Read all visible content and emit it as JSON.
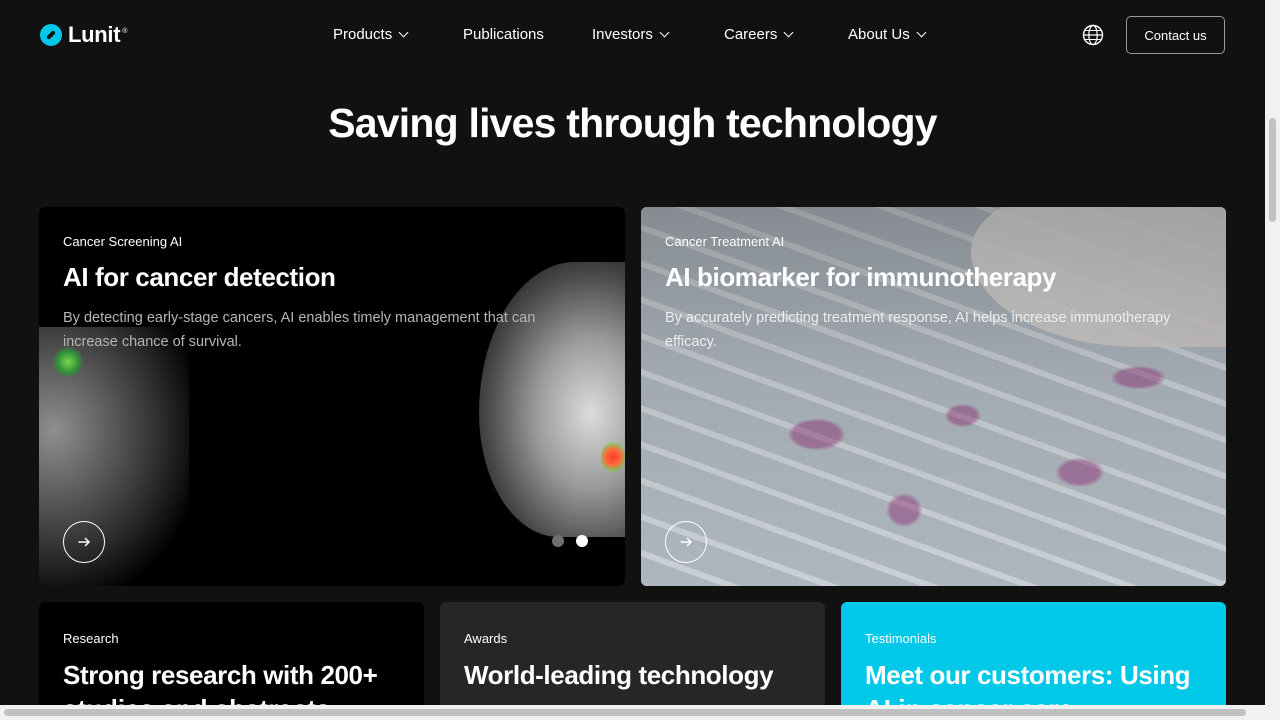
{
  "brand": {
    "name": "Lunit",
    "reg_mark": "®",
    "accent": "#00c8e8",
    "background": "#111111"
  },
  "nav": {
    "items": [
      {
        "label": "Products",
        "has_dropdown": true
      },
      {
        "label": "Publications",
        "has_dropdown": false
      },
      {
        "label": "Investors",
        "has_dropdown": true
      },
      {
        "label": "Careers",
        "has_dropdown": true
      },
      {
        "label": "About Us",
        "has_dropdown": true
      }
    ],
    "language_icon": "globe-icon",
    "contact_label": "Contact us"
  },
  "hero": {
    "title": "Saving lives through technology"
  },
  "feature_cards": [
    {
      "label": "Cancer Screening AI",
      "title": "AI for cancer detection",
      "description": "By detecting early-stage cancers, AI enables timely management that can increase chance of survival.",
      "arrow_icon": "arrow-right-icon",
      "carousel": {
        "dot_count": 2,
        "active_index": 1
      }
    },
    {
      "label": "Cancer Treatment AI",
      "title": "AI biomarker for immunotherapy",
      "description": "By accurately predicting treatment response, AI helps increase immunotherapy efficacy.",
      "arrow_icon": "arrow-right-icon"
    }
  ],
  "info_cards": [
    {
      "label": "Research",
      "title": "Strong research with 200+",
      "title_line2": "studies and abstracts",
      "color": "#000000"
    },
    {
      "label": "Awards",
      "title": "World-leading technology",
      "title_line2": "",
      "color": "#262626"
    },
    {
      "label": "Testimonials",
      "title": "Meet our customers: Using",
      "title_line2": "AI in cancer care",
      "color": "#00c8e8"
    }
  ]
}
